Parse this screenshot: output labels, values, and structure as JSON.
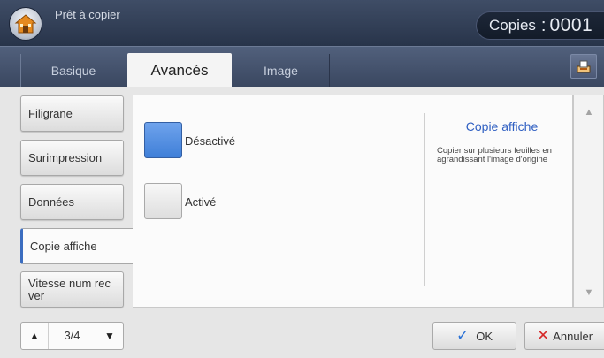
{
  "status": {
    "message": "Prêt à copier",
    "copies_label": "Copies",
    "copies_separator": ":",
    "copies_value": "0001"
  },
  "tabs": [
    {
      "label": "Basique",
      "active": false
    },
    {
      "label": "Avancés",
      "active": true
    },
    {
      "label": "Image",
      "active": false
    }
  ],
  "sidebar": {
    "items": [
      {
        "label": "Filigrane"
      },
      {
        "label": "Surimpression"
      },
      {
        "label": "Données"
      },
      {
        "label": "Copie affiche",
        "active": true
      },
      {
        "label": "Vitesse num rec ver"
      }
    ]
  },
  "options": [
    {
      "label": "Désactivé",
      "selected": true
    },
    {
      "label": "Activé",
      "selected": false
    }
  ],
  "description": {
    "title": "Copie affiche",
    "text": "Copier sur plusieurs feuilles en agrandissant l'image d'origine"
  },
  "pager": {
    "text": "3/4"
  },
  "actions": {
    "ok_label": "OK",
    "cancel_label": "Annuler"
  },
  "colors": {
    "accent": "#2f5fc2",
    "selected_option": "#4f8ee3",
    "ok_icon": "#2b72d6",
    "cancel_icon": "#d62a2a"
  }
}
